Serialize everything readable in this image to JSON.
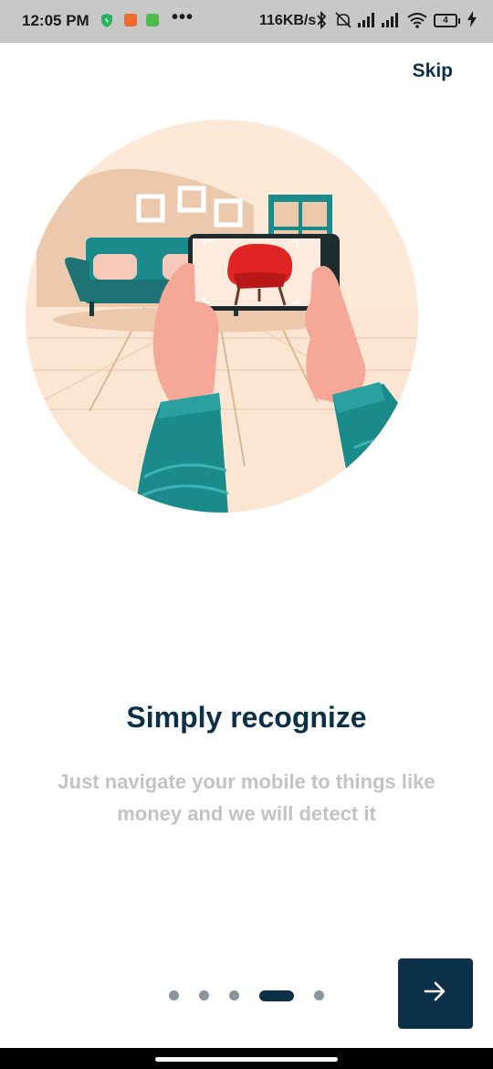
{
  "status_bar": {
    "time": "12:05 PM",
    "app_icons": [
      "shield-icon",
      "app-icon-orange",
      "app-icon-green"
    ],
    "overflow": "•••",
    "network_speed": "116KB/s",
    "battery_level": "4",
    "icons": [
      "bluetooth-icon",
      "mute-icon",
      "signal-icon",
      "signal-icon",
      "wifi-icon",
      "battery-icon",
      "charging-icon"
    ]
  },
  "header": {
    "skip_label": "Skip"
  },
  "onboarding": {
    "illustration": "phone-camera-scanning-room-illustration",
    "title": "Simply recognize",
    "subtitle": "Just navigate your mobile to things like money and we will detect it"
  },
  "pager": {
    "total": 5,
    "current": 4
  },
  "next_button": {
    "icon": "arrow-right-icon"
  },
  "colors": {
    "primary": "#0d3049",
    "subtitle": "#c3c3c3",
    "dot_inactive": "#8a969f",
    "illustration_bg": "#fde9d8",
    "teal": "#1b8a8a",
    "chair": "#e02424"
  }
}
